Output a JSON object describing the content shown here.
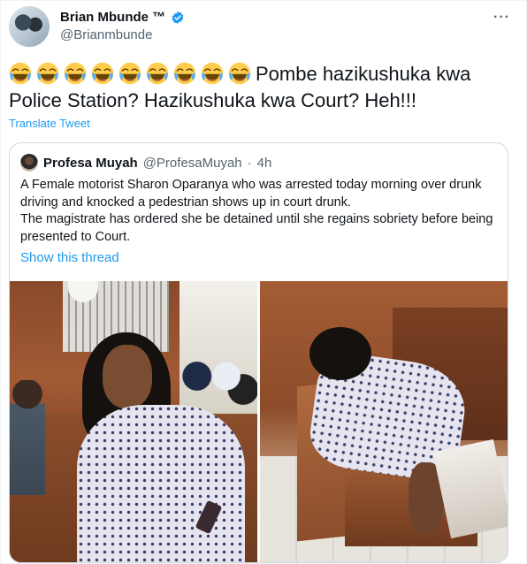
{
  "author": {
    "name": "Brian Mbunde ™",
    "handle": "@Brianmbunde",
    "verified": true
  },
  "tweet": {
    "emoji_name": "face-with-tears-of-joy-icon",
    "emoji_count": 9,
    "text": "Pombe hazikushuka kwa Police Station? Hazikushuka kwa Court? Heh!!!",
    "translate_label": "Translate Tweet"
  },
  "quote": {
    "name": "Profesa Muyah",
    "handle": "@ProfesaMuyah",
    "separator": "·",
    "age": "4h",
    "paragraph_1": "A Female motorist Sharon Oparanya who was arrested today morning over drunk driving and knocked a pedestrian shows up in court drunk.",
    "paragraph_2": "The magistrate has ordered she be detained until she regains sobriety before being presented to Court.",
    "show_thread_label": "Show this thread"
  },
  "colors": {
    "link": "#1d9bf0",
    "secondary_text": "#536471",
    "border": "#cfd9de",
    "verified": "#1d9bf0"
  }
}
